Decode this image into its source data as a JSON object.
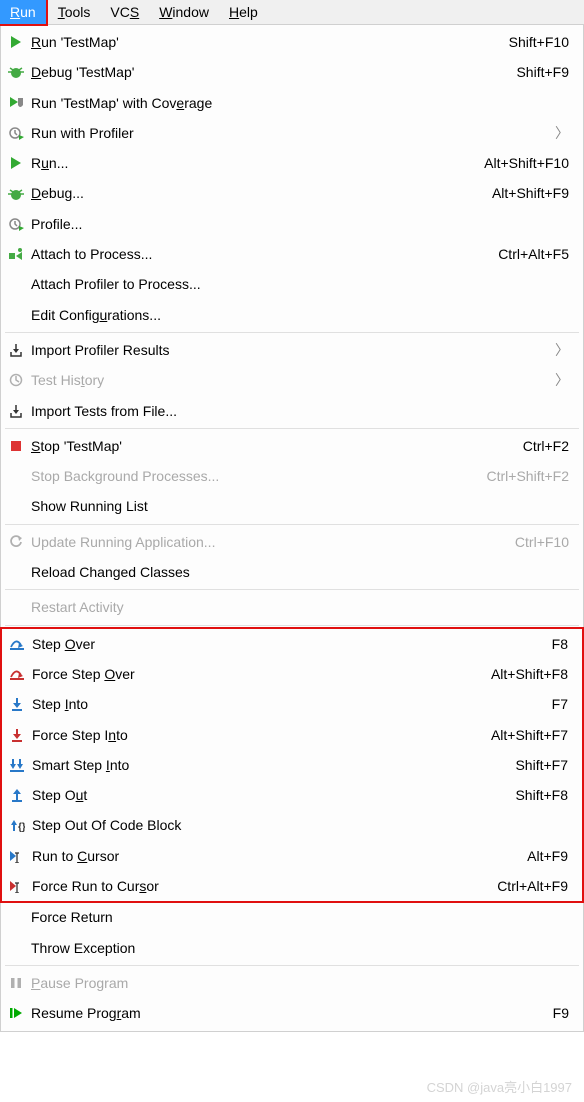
{
  "menubar": [
    {
      "id": "run",
      "label": "Run",
      "selected": true,
      "boxed": true,
      "u": 0
    },
    {
      "id": "tools",
      "label": "Tools",
      "u": 0
    },
    {
      "id": "vcs",
      "label": "VCS",
      "u": 2
    },
    {
      "id": "window",
      "label": "Window",
      "u": 0
    },
    {
      "id": "help",
      "label": "Help",
      "u": 0
    }
  ],
  "groups": [
    {
      "boxed": false,
      "items": [
        {
          "icon": "play-green",
          "label": "Run 'TestMap'",
          "shortcut": "Shift+F10",
          "u": 0
        },
        {
          "icon": "bug-green",
          "label": "Debug 'TestMap'",
          "shortcut": "Shift+F9",
          "u": 0
        },
        {
          "icon": "coverage",
          "label": "Run 'TestMap' with Coverage",
          "u": 22
        },
        {
          "icon": "clock-arrow",
          "label": "Run with Profiler",
          "submenu": true
        },
        {
          "icon": "play-green",
          "label": "Run...",
          "shortcut": "Alt+Shift+F10",
          "u": 1
        },
        {
          "icon": "bug-green",
          "label": "Debug...",
          "shortcut": "Alt+Shift+F9",
          "u": 0
        },
        {
          "icon": "clock-arrow",
          "label": "Profile..."
        },
        {
          "icon": "attach",
          "label": "Attach to Process...",
          "shortcut": "Ctrl+Alt+F5"
        },
        {
          "icon": "",
          "label": "Attach Profiler to Process..."
        },
        {
          "icon": "",
          "label": "Edit Configurations...",
          "u": 11
        }
      ]
    },
    {
      "sep": true
    },
    {
      "boxed": false,
      "items": [
        {
          "icon": "import",
          "label": "Import Profiler Results",
          "submenu": true
        },
        {
          "icon": "clock-grey",
          "label": "Test History",
          "submenu": true,
          "disabled": true,
          "u": 8
        },
        {
          "icon": "import",
          "label": "Import Tests from File..."
        }
      ]
    },
    {
      "sep": true
    },
    {
      "boxed": false,
      "items": [
        {
          "icon": "stop-red",
          "label": "Stop 'TestMap'",
          "shortcut": "Ctrl+F2",
          "u": 0
        },
        {
          "icon": "",
          "label": "Stop Background Processes...",
          "shortcut": "Ctrl+Shift+F2",
          "disabled": true
        },
        {
          "icon": "",
          "label": "Show Running List"
        }
      ]
    },
    {
      "sep": true
    },
    {
      "boxed": false,
      "items": [
        {
          "icon": "refresh-grey",
          "label": "Update Running Application...",
          "shortcut": "Ctrl+F10",
          "disabled": true
        },
        {
          "icon": "",
          "label": "Reload Changed Classes"
        }
      ]
    },
    {
      "sep": true
    },
    {
      "boxed": false,
      "items": [
        {
          "icon": "",
          "label": "Restart Activity",
          "disabled": true
        }
      ]
    },
    {
      "sep": true
    },
    {
      "boxed": true,
      "items": [
        {
          "icon": "step-over",
          "label": "Step Over",
          "shortcut": "F8",
          "u": 5
        },
        {
          "icon": "force-step-over",
          "label": "Force Step Over",
          "shortcut": "Alt+Shift+F8",
          "u": 11
        },
        {
          "icon": "step-into",
          "label": "Step Into",
          "shortcut": "F7",
          "u": 5
        },
        {
          "icon": "force-step-into",
          "label": "Force Step Into",
          "shortcut": "Alt+Shift+F7",
          "u": 12
        },
        {
          "icon": "smart-step-into",
          "label": "Smart Step Into",
          "shortcut": "Shift+F7",
          "u": 11
        },
        {
          "icon": "step-out",
          "label": "Step Out",
          "shortcut": "Shift+F8",
          "u": 6
        },
        {
          "icon": "step-out-block",
          "label": "Step Out Of Code Block"
        },
        {
          "icon": "run-to-cursor",
          "label": "Run to Cursor",
          "shortcut": "Alt+F9",
          "u": 7
        },
        {
          "icon": "force-run-to-cursor",
          "label": "Force Run to Cursor",
          "shortcut": "Ctrl+Alt+F9",
          "u": 16
        }
      ]
    },
    {
      "sep": false,
      "items": [
        {
          "icon": "",
          "label": "Force Return"
        },
        {
          "icon": "",
          "label": "Throw Exception"
        }
      ]
    },
    {
      "sep": true
    },
    {
      "boxed": false,
      "items": [
        {
          "icon": "pause",
          "label": "Pause Program",
          "disabled": true,
          "u": 0
        },
        {
          "icon": "resume",
          "label": "Resume Program",
          "shortcut": "F9",
          "u": 11
        }
      ]
    }
  ],
  "watermark": "CSDN @java亮小白1997"
}
